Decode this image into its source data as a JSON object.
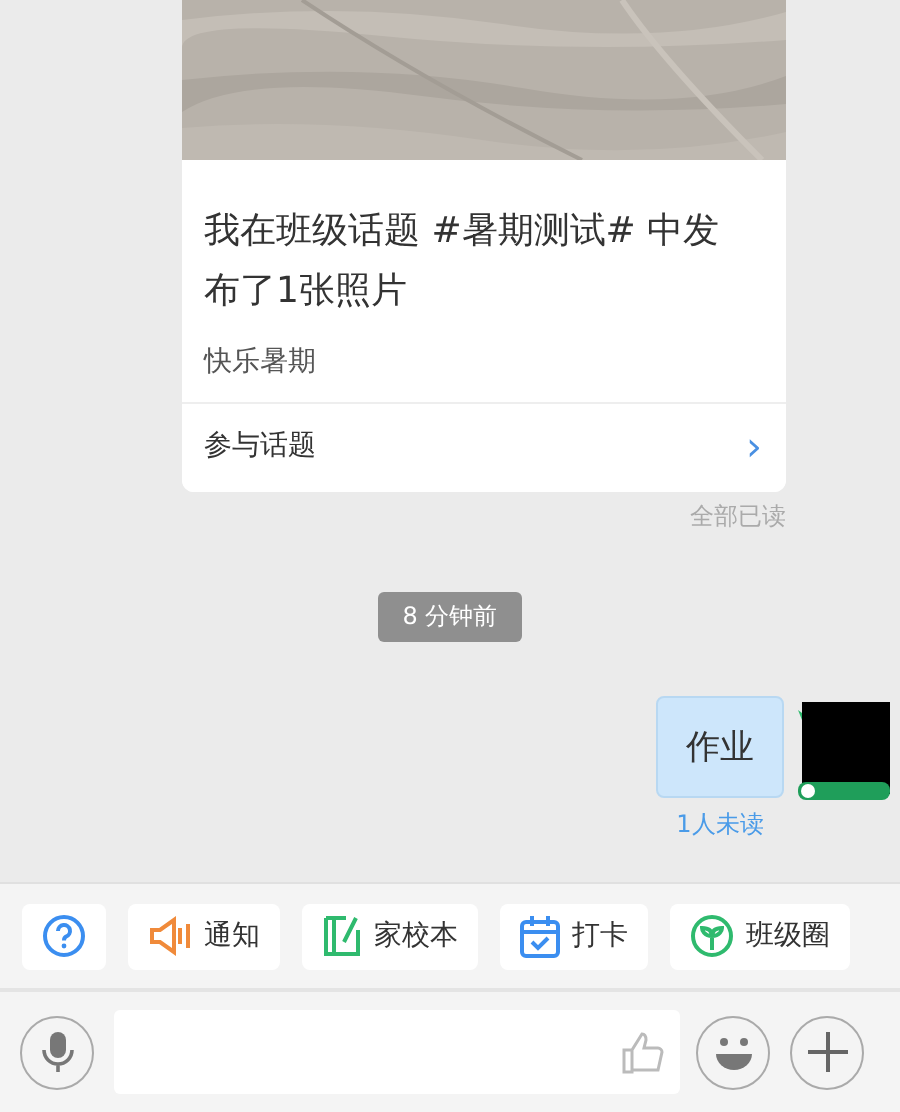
{
  "topic_card": {
    "title": "我在班级话题 #暑期测试# 中发布了1张照片",
    "subtitle": "快乐暑期",
    "action": "参与话题",
    "action_arrow": "›"
  },
  "read_status": "全部已读",
  "time_divider": "8 分钟前",
  "message": {
    "text": "作业",
    "unread": "1人未读"
  },
  "quick_actions": [
    {
      "kind": "help"
    },
    {
      "kind": "notice",
      "label": "通知"
    },
    {
      "kind": "homework",
      "label": "家校本"
    },
    {
      "kind": "checkin",
      "label": "打卡"
    },
    {
      "kind": "circle",
      "label": "班级圈"
    }
  ]
}
